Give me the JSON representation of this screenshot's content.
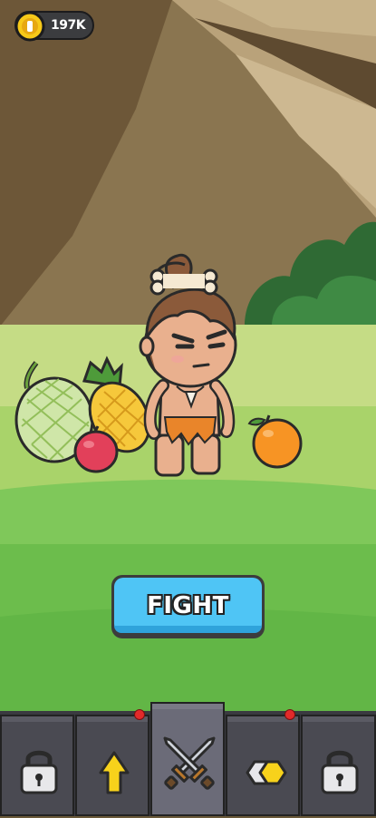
{
  "hud": {
    "coins": "197K",
    "coin_color": "#f7c919"
  },
  "fight_button": {
    "label": "FIGHT",
    "color": "#4fc5f5"
  },
  "scene": {
    "character": "caveman",
    "items": [
      "melon",
      "pineapple",
      "apple",
      "orange"
    ]
  },
  "nav": {
    "tabs": [
      {
        "icon": "lock-icon",
        "state": "locked",
        "badge": false
      },
      {
        "icon": "upgrade-arrow-icon",
        "state": "default",
        "badge": true
      },
      {
        "icon": "crossed-swords-icon",
        "state": "selected",
        "badge": false
      },
      {
        "icon": "gems-icon",
        "state": "default",
        "badge": true
      },
      {
        "icon": "lock-icon",
        "state": "locked",
        "badge": false
      }
    ]
  }
}
